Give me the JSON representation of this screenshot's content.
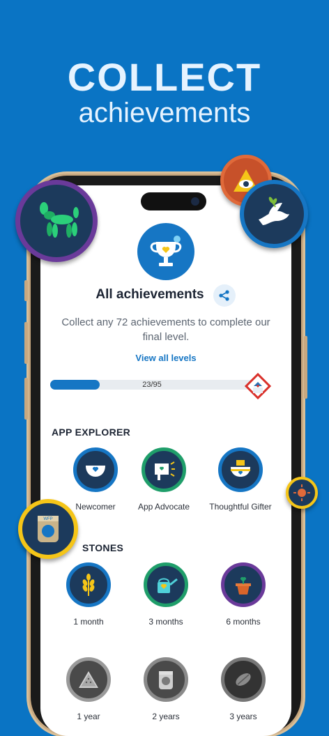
{
  "headline": {
    "line1": "COLLECT",
    "line2": "achievements"
  },
  "screen": {
    "title": "All achievements",
    "description": "Collect any 72 achievements to complete our final level.",
    "view_all": "View all levels",
    "progress": {
      "label": "23/95",
      "current": 23,
      "total": 95
    }
  },
  "sections": {
    "app_explorer": {
      "title": "APP EXPLORER",
      "badges": [
        {
          "label": "Newcomer",
          "icon": "bowl-heart-icon",
          "ring": "#1c3a5c"
        },
        {
          "label": "App Advocate",
          "icon": "megaphone-heart-icon",
          "ring": "#1f9e6a"
        },
        {
          "label": "Thoughtful Gifter",
          "icon": "gift-bowl-icon",
          "ring": "#1c3a5c"
        }
      ]
    },
    "milestones": {
      "title": "STONES",
      "badges": [
        {
          "label": "1 month",
          "icon": "wheat-icon",
          "ring": "#1676c4"
        },
        {
          "label": "3 months",
          "icon": "watering-can-icon",
          "ring": "#1f9e6a"
        },
        {
          "label": "6 months",
          "icon": "plant-pot-icon",
          "ring": "#6a3a9a"
        },
        {
          "label": "1 year",
          "icon": "watermelon-icon",
          "ring": "#8a8a8a"
        },
        {
          "label": "2 years",
          "icon": "wfp-sack-icon",
          "ring": "#7a7a7a"
        },
        {
          "label": "3 years",
          "icon": "seed-icon",
          "ring": "#6a6a6a"
        }
      ]
    }
  },
  "floating_badges": {
    "sack_text": "WFP"
  },
  "colors": {
    "background": "#0a74c4",
    "accent": "#1676c4",
    "title": "#1c2433"
  }
}
